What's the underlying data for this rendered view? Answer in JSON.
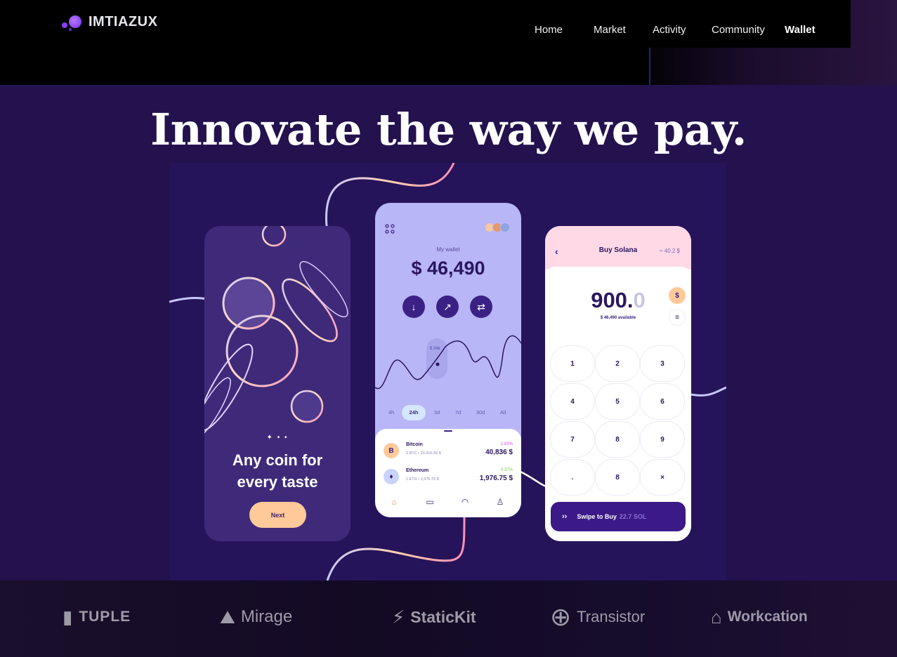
{
  "brand": {
    "name": "IMTIAZUX"
  },
  "nav": {
    "items": [
      {
        "label": "Home"
      },
      {
        "label": "Market"
      },
      {
        "label": "Activity"
      },
      {
        "label": "Community"
      },
      {
        "label": "Wallet",
        "active": true
      }
    ]
  },
  "hero": {
    "title": "Innovate the way we pay."
  },
  "onboarding": {
    "title_line1": "Any coin for",
    "title_line2": "every taste",
    "dots": "✦ • •",
    "next_label": "Next"
  },
  "wallet": {
    "label": "My wallet",
    "balance": "$ 46,490",
    "chart_tooltip": "$ 34k",
    "tabs": [
      "4h",
      "24h",
      "3d",
      "7d",
      "30d",
      "All"
    ],
    "active_tab": "24h",
    "coins": [
      {
        "name": "Bitcoin",
        "amount": "2 BTC",
        "fiat": "20,416.59 $",
        "change": "1.83%",
        "value": "40,836 $",
        "icon": "B"
      },
      {
        "name": "Ethereum",
        "amount": "1 ETH",
        "fiat": "1,976.75 $",
        "change": "0.37%",
        "value": "1,976.75 $",
        "icon": "♦"
      }
    ],
    "bottom_nav": [
      "home-icon",
      "wallet-icon",
      "chart-icon",
      "profile-icon"
    ]
  },
  "buy": {
    "title": "Buy Solana",
    "rate": "≈ 40.2 $",
    "amount_main": "900.",
    "amount_dim": "0",
    "available": "$ 46,490 available",
    "keys": [
      "1",
      "2",
      "3",
      "4",
      "5",
      "6",
      "7",
      "8",
      "9",
      ".",
      "8",
      "×"
    ],
    "swipe_label": "Swipe to Buy",
    "swipe_amount": "22.7 SOL"
  },
  "logos": [
    {
      "name": "TUPLE",
      "icon": "tuple-icon"
    },
    {
      "name": "Mirage",
      "icon": "mirage-icon"
    },
    {
      "name": "StaticKit",
      "icon": "statickit-icon"
    },
    {
      "name": "Transistor",
      "icon": "transistor-icon"
    },
    {
      "name": "Workcation",
      "icon": "workcation-icon"
    }
  ],
  "colors": {
    "hero_bg": "#23124e",
    "accent_purple": "#3b2185",
    "peach": "#ffc99a",
    "lavender": "#b8b6f6"
  }
}
